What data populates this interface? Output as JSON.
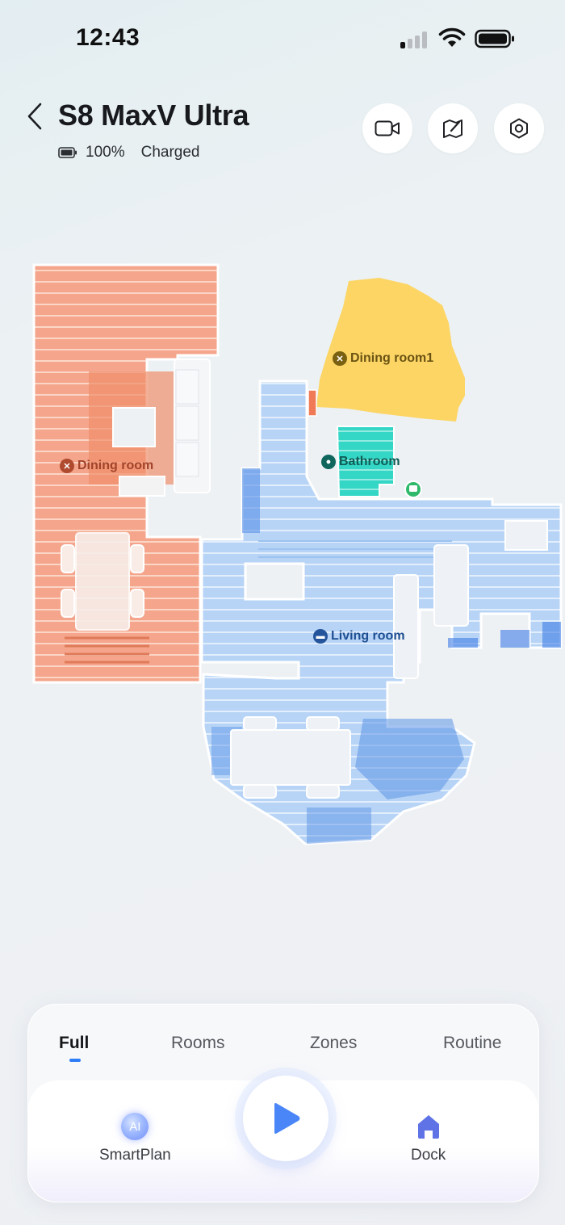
{
  "status_bar": {
    "time": "12:43"
  },
  "header": {
    "device_name": "S8 MaxV Ultra",
    "battery_percent": "100%",
    "battery_status": "Charged",
    "battery_level": 1.0
  },
  "header_buttons": [
    {
      "icon": "camera-icon"
    },
    {
      "icon": "map-edit-icon"
    },
    {
      "icon": "settings-icon"
    }
  ],
  "map": {
    "rooms": [
      {
        "name": "Dining room",
        "color": "#f4a48a",
        "icon": "fork-knife-icon"
      },
      {
        "name": "Dining room1",
        "color": "#fcd565",
        "icon": "fork-knife-icon"
      },
      {
        "name": "Bathroom",
        "color": "#2fd2c3",
        "icon": "toilet-icon"
      },
      {
        "name": "Living room",
        "color": "#a9ccf6",
        "icon": "sofa-icon"
      }
    ]
  },
  "tabs": [
    {
      "label": "Full",
      "active": true
    },
    {
      "label": "Rooms",
      "active": false
    },
    {
      "label": "Zones",
      "active": false
    },
    {
      "label": "Routine",
      "active": false
    }
  ],
  "actions": {
    "smartplan_label": "SmartPlan",
    "smartplan_badge": "AI",
    "dock_label": "Dock"
  },
  "colors": {
    "accent": "#2f7df6",
    "play": "#4a86f7",
    "dock": "#5f73e6"
  }
}
